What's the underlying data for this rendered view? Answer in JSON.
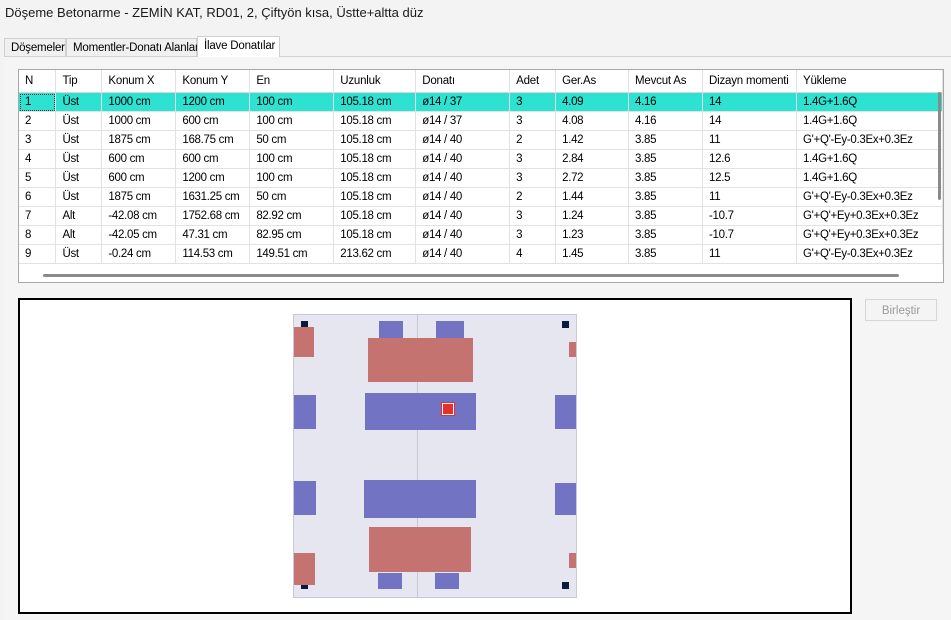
{
  "window": {
    "title": "Döşeme Betonarme - ZEMİN KAT, RD01, 2, Çiftyön kısa, Üstte+altta düz"
  },
  "tabs": [
    {
      "label": "Döşemeler"
    },
    {
      "label": "Momentler-Donatı Alanları"
    },
    {
      "label": "İlave Donatılar"
    }
  ],
  "table": {
    "columns": [
      "N",
      "Tip",
      "Konum X",
      "Konum Y",
      "En",
      "Uzunluk",
      "Donatı",
      "Adet",
      "Ger.As",
      "Mevcut As",
      "Dizayn momenti",
      "Yükleme"
    ],
    "rows": [
      [
        "1",
        "Üst",
        "1000 cm",
        "1200 cm",
        "100 cm",
        "105.18 cm",
        "ø14 / 37",
        "3",
        "4.09",
        "4.16",
        "14",
        "1.4G+1.6Q"
      ],
      [
        "2",
        "Üst",
        "1000 cm",
        "600 cm",
        "100 cm",
        "105.18 cm",
        "ø14 / 37",
        "3",
        "4.08",
        "4.16",
        "14",
        "1.4G+1.6Q"
      ],
      [
        "3",
        "Üst",
        "1875 cm",
        "168.75 cm",
        "50 cm",
        "105.18 cm",
        "ø14 / 40",
        "2",
        "1.42",
        "3.85",
        "11",
        "G'+Q'-Ey-0.3Ex+0.3Ez"
      ],
      [
        "4",
        "Üst",
        "600 cm",
        "600 cm",
        "100 cm",
        "105.18 cm",
        "ø14 / 40",
        "3",
        "2.84",
        "3.85",
        "12.6",
        "1.4G+1.6Q"
      ],
      [
        "5",
        "Üst",
        "600 cm",
        "1200 cm",
        "100 cm",
        "105.18 cm",
        "ø14 / 40",
        "3",
        "2.72",
        "3.85",
        "12.5",
        "1.4G+1.6Q"
      ],
      [
        "6",
        "Üst",
        "1875 cm",
        "1631.25 cm",
        "50 cm",
        "105.18 cm",
        "ø14 / 40",
        "2",
        "1.44",
        "3.85",
        "11",
        "G'+Q'-Ey-0.3Ex+0.3Ez"
      ],
      [
        "7",
        "Alt",
        "-42.08 cm",
        "1752.68 cm",
        "82.92 cm",
        "105.18 cm",
        "ø14 / 40",
        "3",
        "1.24",
        "3.85",
        "-10.7",
        "G'+Q'+Ey+0.3Ex+0.3Ez"
      ],
      [
        "8",
        "Alt",
        "-42.05 cm",
        "47.31 cm",
        "82.95 cm",
        "105.18 cm",
        "ø14 / 40",
        "3",
        "1.23",
        "3.85",
        "-10.7",
        "G'+Q'+Ey+0.3Ex+0.3Ez"
      ],
      [
        "9",
        "Üst",
        "-0.24 cm",
        "114.53 cm",
        "149.51 cm",
        "213.62 cm",
        "ø14 / 40",
        "4",
        "1.45",
        "3.85",
        "11",
        "G'+Q'-Ey-0.3Ex+0.3Ez"
      ]
    ],
    "selected_row": 0
  },
  "buttons": {
    "merge": "Birleştir"
  },
  "colors": {
    "selection": "#2ee2d2",
    "top_rebar": "#7373c3",
    "bottom_rebar": "#c57370",
    "marker": "#e63030"
  }
}
